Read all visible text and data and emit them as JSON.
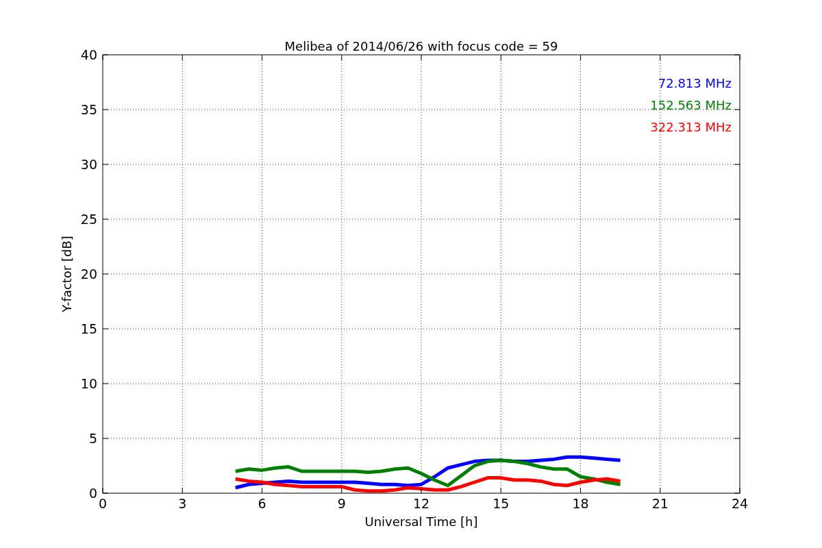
{
  "chart_data": {
    "type": "line",
    "title": "Melibea of 2014/06/26 with focus code = 59",
    "xlabel": "Universal Time [h]",
    "ylabel": "Y-factor [dB]",
    "x": [
      5,
      5.5,
      6,
      6.5,
      7,
      7.5,
      8,
      8.5,
      9,
      9.5,
      10,
      10.5,
      11,
      11.5,
      12,
      12.5,
      13,
      13.5,
      14,
      14.5,
      15,
      15.5,
      16,
      16.5,
      17,
      17.5,
      18,
      18.5,
      19,
      19.5
    ],
    "series": [
      {
        "name": "72.813 MHz",
        "color": "#0000ff",
        "values": [
          0.5,
          0.8,
          0.9,
          1.0,
          1.1,
          1.0,
          1.0,
          1.0,
          1.0,
          1.0,
          0.9,
          0.8,
          0.8,
          0.7,
          0.8,
          1.5,
          2.3,
          2.6,
          2.9,
          3.0,
          3.0,
          2.9,
          2.9,
          3.0,
          3.1,
          3.3,
          3.3,
          3.2,
          3.1,
          3.0
        ]
      },
      {
        "name": "152.563 MHz",
        "color": "#008000",
        "values": [
          2.0,
          2.2,
          2.1,
          2.3,
          2.4,
          2.0,
          2.0,
          2.0,
          2.0,
          2.0,
          1.9,
          2.0,
          2.2,
          2.3,
          1.8,
          1.2,
          0.7,
          1.6,
          2.5,
          2.9,
          3.0,
          2.9,
          2.7,
          2.4,
          2.2,
          2.2,
          1.5,
          1.3,
          1.0,
          0.8
        ]
      },
      {
        "name": "322.313 MHz",
        "color": "#ff0000",
        "values": [
          1.3,
          1.1,
          1.0,
          0.8,
          0.7,
          0.6,
          0.6,
          0.6,
          0.6,
          0.3,
          0.2,
          0.2,
          0.3,
          0.5,
          0.4,
          0.3,
          0.3,
          0.6,
          1.0,
          1.4,
          1.4,
          1.2,
          1.2,
          1.1,
          0.8,
          0.7,
          1.0,
          1.2,
          1.3,
          1.1
        ]
      }
    ],
    "grid": true,
    "xlim": [
      0,
      24
    ],
    "ylim": [
      0,
      40
    ],
    "xticks": [
      0,
      3,
      6,
      9,
      12,
      15,
      18,
      21,
      24
    ],
    "yticks": [
      0,
      5,
      10,
      15,
      20,
      25,
      30,
      35,
      40
    ]
  }
}
